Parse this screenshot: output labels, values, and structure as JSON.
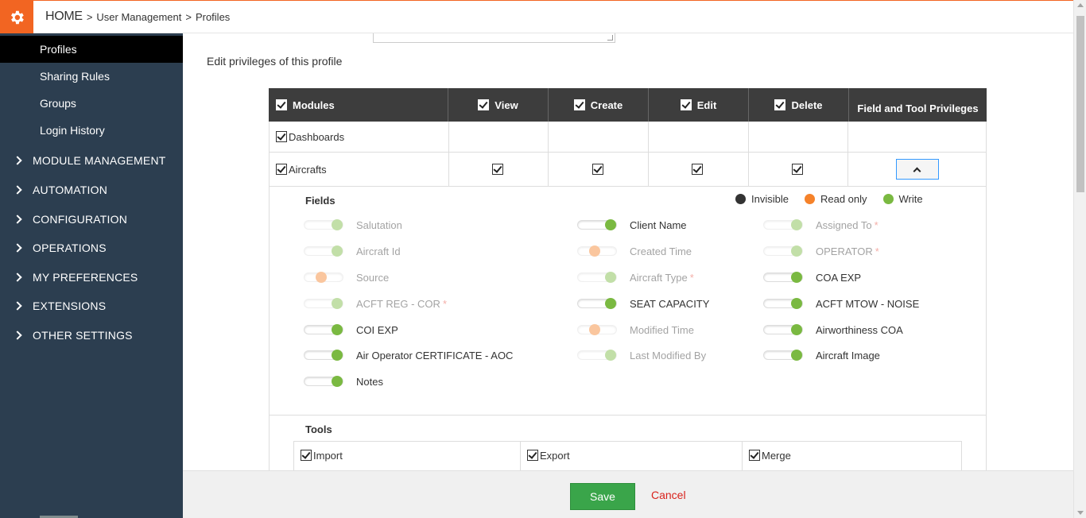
{
  "breadcrumb": {
    "home": "HOME",
    "section": "User Management",
    "page": "Profiles",
    "sep": ">"
  },
  "sidebar": {
    "sub_items": [
      {
        "label": "Profiles",
        "active": true
      },
      {
        "label": "Sharing Rules",
        "active": false
      },
      {
        "label": "Groups",
        "active": false
      },
      {
        "label": "Login History",
        "active": false
      }
    ],
    "menu": [
      {
        "label": "MODULE MANAGEMENT"
      },
      {
        "label": "AUTOMATION"
      },
      {
        "label": "CONFIGURATION"
      },
      {
        "label": "OPERATIONS"
      },
      {
        "label": "MY PREFERENCES"
      },
      {
        "label": "EXTENSIONS"
      },
      {
        "label": "OTHER SETTINGS"
      }
    ]
  },
  "section_title": "Edit privileges of this profile",
  "table": {
    "headers": {
      "modules": "Modules",
      "view": "View",
      "create": "Create",
      "edit": "Edit",
      "delete": "Delete",
      "ftp": "Field and Tool Privileges"
    },
    "rows": [
      {
        "module": "Dashboards"
      },
      {
        "module": "Aircrafts"
      }
    ]
  },
  "fields": {
    "title": "Fields",
    "legend": [
      {
        "label": "Invisible",
        "color": "#333333"
      },
      {
        "label": "Read only",
        "color": "#f5822a"
      },
      {
        "label": "Write",
        "color": "#7ab941"
      }
    ],
    "items": [
      {
        "label": "Salutation",
        "state": "write",
        "dim": true,
        "required": false
      },
      {
        "label": "Aircraft Id",
        "state": "write",
        "dim": true,
        "required": false
      },
      {
        "label": "Source",
        "state": "readonly",
        "dim": true,
        "required": false
      },
      {
        "label": "ACFT REG - COR",
        "state": "write",
        "dim": true,
        "required": true
      },
      {
        "label": "COI EXP",
        "state": "write",
        "dim": false,
        "required": false
      },
      {
        "label": "Air Operator CERTIFICATE - AOC",
        "state": "write",
        "dim": false,
        "required": false
      },
      {
        "label": "Notes",
        "state": "write",
        "dim": false,
        "required": false
      },
      {
        "label": "Client Name",
        "state": "write",
        "dim": false,
        "required": false
      },
      {
        "label": "Created Time",
        "state": "readonly",
        "dim": true,
        "required": false
      },
      {
        "label": "Aircraft Type",
        "state": "write",
        "dim": true,
        "required": true
      },
      {
        "label": "SEAT CAPACITY",
        "state": "write",
        "dim": false,
        "required": false
      },
      {
        "label": "Modified Time",
        "state": "readonly",
        "dim": true,
        "required": false
      },
      {
        "label": "Last Modified By",
        "state": "write",
        "dim": true,
        "required": false
      },
      {
        "label": "Assigned To",
        "state": "write",
        "dim": true,
        "required": true
      },
      {
        "label": "OPERATOR",
        "state": "write",
        "dim": true,
        "required": true
      },
      {
        "label": "COA EXP",
        "state": "write",
        "dim": false,
        "required": false
      },
      {
        "label": "ACFT MTOW - NOISE",
        "state": "write",
        "dim": false,
        "required": false
      },
      {
        "label": "Airworthiness COA",
        "state": "write",
        "dim": false,
        "required": false
      },
      {
        "label": "Aircraft Image",
        "state": "write",
        "dim": false,
        "required": false
      }
    ],
    "required_mark": "*"
  },
  "tools": {
    "title": "Tools",
    "items": [
      {
        "label": "Import"
      },
      {
        "label": "Export"
      },
      {
        "label": "Merge"
      }
    ]
  },
  "footer": {
    "save_label": "Save",
    "cancel_label": "Cancel"
  },
  "colors": {
    "accent": "#f26522",
    "sidebar": "#2c3e50",
    "write": "#7ab941",
    "readonly": "#f5822a",
    "invisible": "#333333",
    "save": "#3aa54a",
    "cancel": "#d9231d"
  }
}
